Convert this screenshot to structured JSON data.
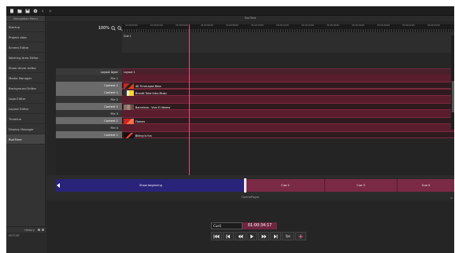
{
  "nav": {
    "header": "Navigation Menu",
    "items": [
      {
        "label": "Startup"
      },
      {
        "label": "Project data"
      },
      {
        "label": "Screen Editor"
      },
      {
        "label": "Working Area Editor"
      },
      {
        "label": "Show driver editor"
      },
      {
        "label": "Media Manager"
      },
      {
        "label": "Background Editor"
      },
      {
        "label": "Logo Editor"
      },
      {
        "label": "Layout Editor"
      },
      {
        "label": "Timeline"
      },
      {
        "label": "Display Manager"
      },
      {
        "label": "RunTime"
      }
    ],
    "active_index": 11,
    "history_label": "History",
    "history_item": "HISTORY"
  },
  "main": {
    "title": "RunTime",
    "zoom": "100%",
    "cue_lane_label": "Cue 1",
    "layout_layer_label": "Layout layer",
    "layout_name": "Layout 1",
    "files": [
      {
        "file_label": "File 1",
        "content_label": "Content 1",
        "clip_title": "4K TimeLapse Beta"
      },
      {
        "file_label": "File 2",
        "content_label": "Content 1",
        "clip_title": "Brandt Tube Intro Music"
      },
      {
        "file_label": "File 2",
        "content_label": "Content 1",
        "clip_title": "Barcelona - Vive El Idioma"
      },
      {
        "file_label": "File 3",
        "content_label": "Content 1",
        "clip_title": "Flames"
      },
      {
        "file_label": "File 4",
        "content_label": "Content 1",
        "clip_title": "Biking is fun"
      }
    ],
    "ruler_labels": [
      "01:00:00:00",
      "01:00:02:00",
      "01:00:04:00",
      "01:00:06:00",
      "01:00:08:00",
      "01:00:10:00",
      "01:00:12:00",
      "01:00:14:00",
      "01:00:16:00",
      "01:00:18:00",
      "01:00:20:00",
      "01:00:22:00",
      "01:00:24:00"
    ]
  },
  "cuebar": {
    "segments": [
      {
        "label": "Show beginning"
      },
      {
        "label": "Cue 2"
      },
      {
        "label": "Cue 3"
      },
      {
        "label": "Cue 4"
      }
    ]
  },
  "control": {
    "title": "ControlPlayer",
    "close": "×",
    "cue_name": "Cue1",
    "timecode": "01:00:34:17",
    "fps_label": "fps"
  },
  "colors": {
    "accent": "#6e2640",
    "begin_segment": "#2a237a",
    "playhead": "#e0507a"
  }
}
